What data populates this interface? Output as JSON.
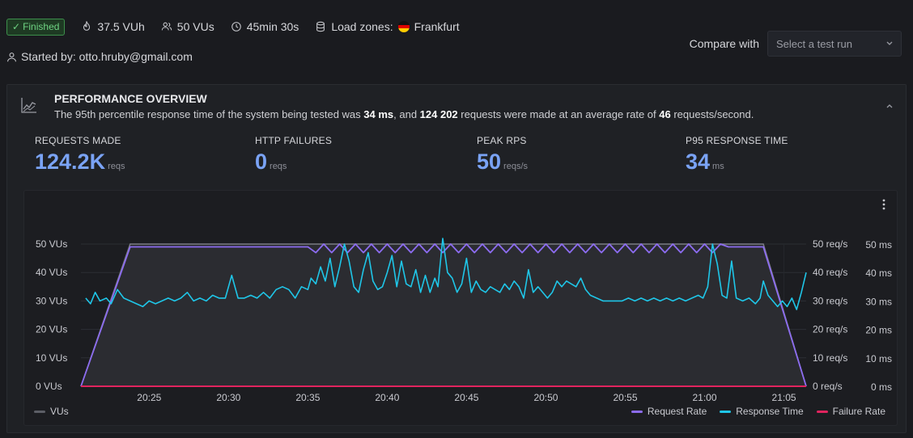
{
  "header": {
    "status": "Finished",
    "vuh": "37.5 VUh",
    "vus": "50 VUs",
    "duration": "45min 30s",
    "load_zones_label": "Load zones:",
    "load_zone": "Frankfurt",
    "started_by": "Started by: otto.hruby@gmail.com",
    "compare_label": "Compare with",
    "compare_placeholder": "Select a test run"
  },
  "overview": {
    "title": "PERFORMANCE OVERVIEW",
    "desc_1": "The 95th percentile response time of the system being tested was ",
    "desc_p95": "34 ms",
    "desc_2": ", and ",
    "desc_requests": "124 202",
    "desc_3": " requests were made at an average rate of ",
    "desc_rate": "46",
    "desc_4": " requests/second.",
    "kpis": [
      {
        "label": "REQUESTS MADE",
        "value": "124.2K",
        "unit": "reqs"
      },
      {
        "label": "HTTP FAILURES",
        "value": "0",
        "unit": "reqs"
      },
      {
        "label": "PEAK RPS",
        "value": "50",
        "unit": "reqs/s"
      },
      {
        "label": "P95 RESPONSE TIME",
        "value": "34",
        "unit": "ms"
      }
    ]
  },
  "colors": {
    "vus": "#7a7c84",
    "request_rate": "#8c6cf0",
    "response_time": "#1fc6e8",
    "failure_rate": "#e0245e",
    "accent": "#7aa3f5"
  },
  "chart_data": {
    "type": "line",
    "x_ticks": [
      "20:25",
      "20:30",
      "20:35",
      "20:40",
      "20:45",
      "20:50",
      "20:55",
      "21:00",
      "21:05"
    ],
    "x_range_minutes": [
      20.7,
      66.4
    ],
    "y_left_ticks": [
      "0 VUs",
      "10 VUs",
      "20 VUs",
      "30 VUs",
      "40 VUs",
      "50 VUs"
    ],
    "y_right_rps_ticks": [
      "0 req/s",
      "10 req/s",
      "20 req/s",
      "30 req/s",
      "40 req/s",
      "50 req/s"
    ],
    "y_right_ms_ticks": [
      "0 ms",
      "10 ms",
      "20 ms",
      "30 ms",
      "40 ms",
      "50 ms"
    ],
    "ylim": [
      0,
      50
    ],
    "series": [
      {
        "name": "VUs",
        "points": [
          [
            20.7,
            0
          ],
          [
            23.8,
            50
          ],
          [
            63.7,
            50
          ],
          [
            66.4,
            0
          ]
        ]
      },
      {
        "name": "Request Rate",
        "points": [
          [
            20.7,
            0
          ],
          [
            23.8,
            49
          ],
          [
            35.0,
            49
          ],
          [
            35.5,
            47
          ],
          [
            36.0,
            50
          ],
          [
            36.5,
            47
          ],
          [
            37.0,
            50
          ],
          [
            37.5,
            47
          ],
          [
            38.0,
            50
          ],
          [
            38.5,
            47
          ],
          [
            39.0,
            50
          ],
          [
            39.5,
            47
          ],
          [
            40.0,
            50
          ],
          [
            40.5,
            47
          ],
          [
            41.0,
            50
          ],
          [
            41.5,
            47
          ],
          [
            42.0,
            50
          ],
          [
            42.5,
            47
          ],
          [
            43.0,
            50
          ],
          [
            43.5,
            47
          ],
          [
            44.0,
            50
          ],
          [
            44.5,
            47
          ],
          [
            45.0,
            50
          ],
          [
            45.5,
            47
          ],
          [
            46.0,
            50
          ],
          [
            46.5,
            47
          ],
          [
            47.0,
            50
          ],
          [
            47.5,
            47
          ],
          [
            48.0,
            50
          ],
          [
            48.5,
            47
          ],
          [
            49.0,
            50
          ],
          [
            49.5,
            47
          ],
          [
            50.0,
            50
          ],
          [
            50.5,
            47
          ],
          [
            51.0,
            50
          ],
          [
            51.5,
            47
          ],
          [
            52.0,
            50
          ],
          [
            52.5,
            47
          ],
          [
            53.0,
            50
          ],
          [
            53.5,
            47
          ],
          [
            54.0,
            50
          ],
          [
            54.5,
            47
          ],
          [
            55.0,
            50
          ],
          [
            55.5,
            47
          ],
          [
            56.0,
            50
          ],
          [
            56.5,
            47
          ],
          [
            57.0,
            50
          ],
          [
            57.5,
            47
          ],
          [
            58.0,
            50
          ],
          [
            58.5,
            47
          ],
          [
            59.0,
            50
          ],
          [
            59.5,
            47
          ],
          [
            60.0,
            50
          ],
          [
            60.5,
            47
          ],
          [
            61.0,
            50
          ],
          [
            61.5,
            49
          ],
          [
            63.7,
            49
          ],
          [
            66.4,
            0
          ]
        ]
      },
      {
        "name": "Response Time",
        "points": [
          [
            21.0,
            31
          ],
          [
            21.3,
            29
          ],
          [
            21.6,
            33
          ],
          [
            21.9,
            30
          ],
          [
            22.3,
            31
          ],
          [
            22.6,
            29
          ],
          [
            23.0,
            34
          ],
          [
            23.4,
            31
          ],
          [
            23.8,
            30
          ],
          [
            24.2,
            29
          ],
          [
            24.6,
            28
          ],
          [
            25.0,
            30
          ],
          [
            25.4,
            29
          ],
          [
            25.8,
            30
          ],
          [
            26.2,
            31
          ],
          [
            26.6,
            30
          ],
          [
            27.0,
            31
          ],
          [
            27.4,
            33
          ],
          [
            27.8,
            30
          ],
          [
            28.2,
            31
          ],
          [
            28.6,
            30
          ],
          [
            29.0,
            32
          ],
          [
            29.4,
            31
          ],
          [
            29.8,
            31
          ],
          [
            30.2,
            39
          ],
          [
            30.6,
            31
          ],
          [
            31.0,
            31
          ],
          [
            31.4,
            32
          ],
          [
            31.8,
            31
          ],
          [
            32.2,
            33
          ],
          [
            32.6,
            31
          ],
          [
            33.0,
            34
          ],
          [
            33.4,
            35
          ],
          [
            33.8,
            34
          ],
          [
            34.2,
            31
          ],
          [
            34.6,
            35
          ],
          [
            35.0,
            34
          ],
          [
            35.2,
            38
          ],
          [
            35.5,
            36
          ],
          [
            35.8,
            42
          ],
          [
            36.1,
            37
          ],
          [
            36.4,
            45
          ],
          [
            36.7,
            35
          ],
          [
            37.0,
            42
          ],
          [
            37.3,
            50
          ],
          [
            37.6,
            44
          ],
          [
            37.9,
            35
          ],
          [
            38.2,
            33
          ],
          [
            38.5,
            41
          ],
          [
            38.8,
            47
          ],
          [
            39.1,
            37
          ],
          [
            39.4,
            34
          ],
          [
            39.7,
            35
          ],
          [
            40.0,
            40
          ],
          [
            40.3,
            46
          ],
          [
            40.6,
            35
          ],
          [
            40.9,
            44
          ],
          [
            41.2,
            36
          ],
          [
            41.5,
            35
          ],
          [
            41.8,
            41
          ],
          [
            42.1,
            33
          ],
          [
            42.4,
            39
          ],
          [
            42.7,
            33
          ],
          [
            43.0,
            38
          ],
          [
            43.2,
            35
          ],
          [
            43.5,
            52
          ],
          [
            43.8,
            40
          ],
          [
            44.1,
            38
          ],
          [
            44.4,
            33
          ],
          [
            44.7,
            36
          ],
          [
            45.0,
            45
          ],
          [
            45.3,
            33
          ],
          [
            45.6,
            37
          ],
          [
            45.9,
            34
          ],
          [
            46.2,
            33
          ],
          [
            46.5,
            35
          ],
          [
            46.8,
            34
          ],
          [
            47.1,
            33
          ],
          [
            47.4,
            36
          ],
          [
            47.7,
            34
          ],
          [
            48.0,
            37
          ],
          [
            48.3,
            35
          ],
          [
            48.6,
            31
          ],
          [
            48.9,
            41
          ],
          [
            49.2,
            33
          ],
          [
            49.5,
            35
          ],
          [
            49.8,
            33
          ],
          [
            50.1,
            31
          ],
          [
            50.4,
            33
          ],
          [
            50.7,
            37
          ],
          [
            51.0,
            35
          ],
          [
            51.3,
            37
          ],
          [
            51.6,
            36
          ],
          [
            51.9,
            35
          ],
          [
            52.2,
            38
          ],
          [
            52.5,
            34
          ],
          [
            52.8,
            32
          ],
          [
            53.2,
            31
          ],
          [
            53.6,
            30
          ],
          [
            54.0,
            30
          ],
          [
            54.4,
            30
          ],
          [
            54.8,
            30
          ],
          [
            55.2,
            31
          ],
          [
            55.6,
            30
          ],
          [
            56.0,
            31
          ],
          [
            56.4,
            30
          ],
          [
            56.8,
            31
          ],
          [
            57.2,
            30
          ],
          [
            57.6,
            31
          ],
          [
            58.0,
            30
          ],
          [
            58.4,
            31
          ],
          [
            58.8,
            30
          ],
          [
            59.2,
            31
          ],
          [
            59.6,
            32
          ],
          [
            59.9,
            31
          ],
          [
            60.2,
            35
          ],
          [
            60.5,
            50
          ],
          [
            60.8,
            43
          ],
          [
            61.1,
            32
          ],
          [
            61.4,
            31
          ],
          [
            61.7,
            44
          ],
          [
            62.0,
            31
          ],
          [
            62.4,
            30
          ],
          [
            62.8,
            31
          ],
          [
            63.2,
            29
          ],
          [
            63.5,
            31
          ],
          [
            63.7,
            37
          ],
          [
            64.0,
            32
          ],
          [
            64.3,
            30
          ],
          [
            64.6,
            28
          ],
          [
            64.9,
            30
          ],
          [
            65.2,
            28
          ],
          [
            65.5,
            31
          ],
          [
            65.8,
            27
          ],
          [
            66.1,
            33
          ],
          [
            66.4,
            40
          ]
        ]
      },
      {
        "name": "Failure Rate",
        "points": [
          [
            20.7,
            0
          ],
          [
            66.4,
            0
          ]
        ]
      }
    ],
    "legend": [
      "VUs",
      "Request Rate",
      "Response Time",
      "Failure Rate"
    ],
    "grid": true
  }
}
